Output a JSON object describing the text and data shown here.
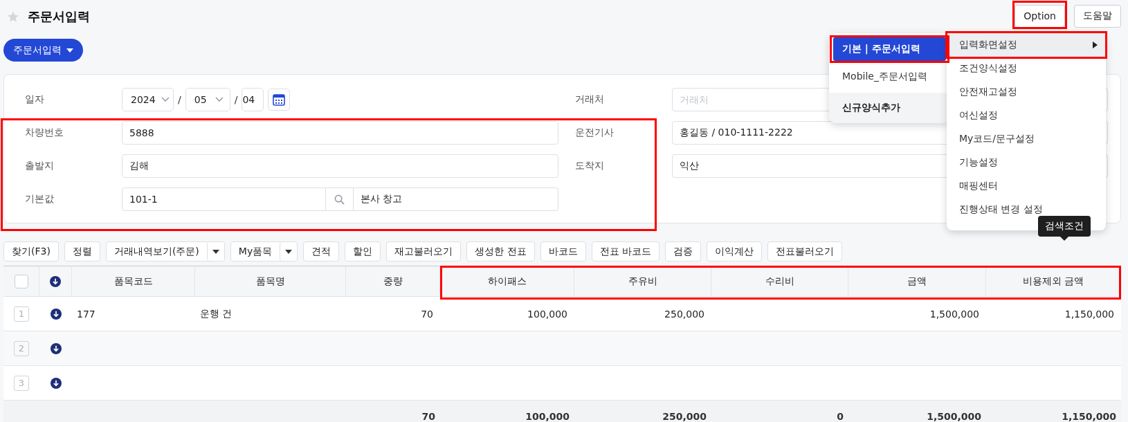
{
  "header": {
    "title": "주문서입력",
    "favorite": false,
    "buttons": [
      {
        "label": "Option",
        "highlighted": true
      },
      {
        "label": "도움말",
        "highlighted": false
      }
    ]
  },
  "form_selector": {
    "label": "주문서입력"
  },
  "form": {
    "rows": [
      {
        "kind": "date",
        "label": "일자",
        "year": "2024",
        "month": "05",
        "day": "04",
        "separators": [
          "/",
          "/"
        ],
        "right": {
          "label": "거래처",
          "placeholder": "거래처"
        },
        "highlighted": false
      },
      {
        "kind": "text",
        "label": "차량번호",
        "value": "5888",
        "right": {
          "label": "운전기사",
          "value": "홍길동 / 010-1111-2222"
        },
        "highlighted": true
      },
      {
        "kind": "text",
        "label": "출발지",
        "value": "김해",
        "right": {
          "label": "도착지",
          "value": "익산"
        },
        "highlighted": true
      },
      {
        "kind": "lookup",
        "label": "기본값",
        "code": "101-1",
        "name": "본사 창고",
        "highlighted": true
      }
    ]
  },
  "toolbar": [
    {
      "kind": "plain",
      "label": "찾기(F3)"
    },
    {
      "kind": "plain",
      "label": "정렬"
    },
    {
      "kind": "split",
      "label": "거래내역보기(주문)"
    },
    {
      "kind": "split",
      "label": "My품목"
    },
    {
      "kind": "plain",
      "label": "견적"
    },
    {
      "kind": "plain",
      "label": "할인"
    },
    {
      "kind": "plain",
      "label": "재고불러오기"
    },
    {
      "kind": "plain",
      "label": "생성한 전표"
    },
    {
      "kind": "plain",
      "label": "바코드"
    },
    {
      "kind": "plain",
      "label": "전표 바코드"
    },
    {
      "kind": "plain",
      "label": "검증"
    },
    {
      "kind": "plain",
      "label": "이익계산"
    },
    {
      "kind": "plain",
      "label": "전표불러오기"
    }
  ],
  "table": {
    "columns": [
      {
        "kind": "checkbox",
        "checked": false,
        "highlighted": false
      },
      {
        "kind": "icon",
        "highlighted": false
      },
      {
        "kind": "text",
        "label": "품목코드",
        "numeric": false,
        "highlighted": false
      },
      {
        "kind": "text",
        "label": "품목명",
        "numeric": false,
        "highlighted": false
      },
      {
        "kind": "text",
        "label": "중량",
        "numeric": true,
        "highlighted": false
      },
      {
        "kind": "text",
        "label": "하이패스",
        "numeric": true,
        "highlighted": true
      },
      {
        "kind": "text",
        "label": "주유비",
        "numeric": true,
        "highlighted": true
      },
      {
        "kind": "text",
        "label": "수리비",
        "numeric": true,
        "highlighted": true
      },
      {
        "kind": "text",
        "label": "금액",
        "numeric": true,
        "highlighted": true
      },
      {
        "kind": "text",
        "label": "비용제외 금액",
        "numeric": true,
        "highlighted": true
      }
    ],
    "rows": [
      {
        "number": "1",
        "cells": [
          "177",
          "운행 건",
          "70",
          "100,000",
          "250,000",
          null,
          "1,500,000",
          "1,150,000"
        ]
      },
      {
        "number": "2"
      },
      {
        "number": "3"
      }
    ],
    "totals": [
      "70",
      "100,000",
      "250,000",
      "0",
      "1,500,000",
      "1,150,000"
    ]
  },
  "form_list_menu": {
    "items": [
      {
        "kind": "item",
        "label": "기본 | 주문서입력",
        "selected": true,
        "highlighted": true
      },
      {
        "kind": "item",
        "label": "Mobile_주문서입력",
        "selected": false,
        "highlighted": false
      },
      {
        "kind": "action",
        "label": "신규양식추가",
        "selected": false,
        "highlighted": false
      }
    ]
  },
  "option_menu": {
    "items": [
      {
        "label": "입력화면설정",
        "selected": true,
        "has_submenu": true,
        "highlighted": true
      },
      {
        "label": "조건양식설정",
        "selected": false,
        "has_submenu": false,
        "highlighted": false
      },
      {
        "label": "안전재고설정",
        "selected": false,
        "has_submenu": false,
        "highlighted": false
      },
      {
        "label": "여신설정",
        "selected": false,
        "has_submenu": false,
        "highlighted": false
      },
      {
        "label": "My코드/문구설정",
        "selected": false,
        "has_submenu": false,
        "highlighted": false
      },
      {
        "label": "기능설정",
        "selected": false,
        "has_submenu": false,
        "highlighted": false
      },
      {
        "label": "매핑센터",
        "selected": false,
        "has_submenu": false,
        "highlighted": false
      },
      {
        "label": "진행상태 변경 설정",
        "selected": false,
        "has_submenu": false,
        "highlighted": false
      }
    ]
  },
  "tooltip": {
    "text": "검색조건"
  }
}
